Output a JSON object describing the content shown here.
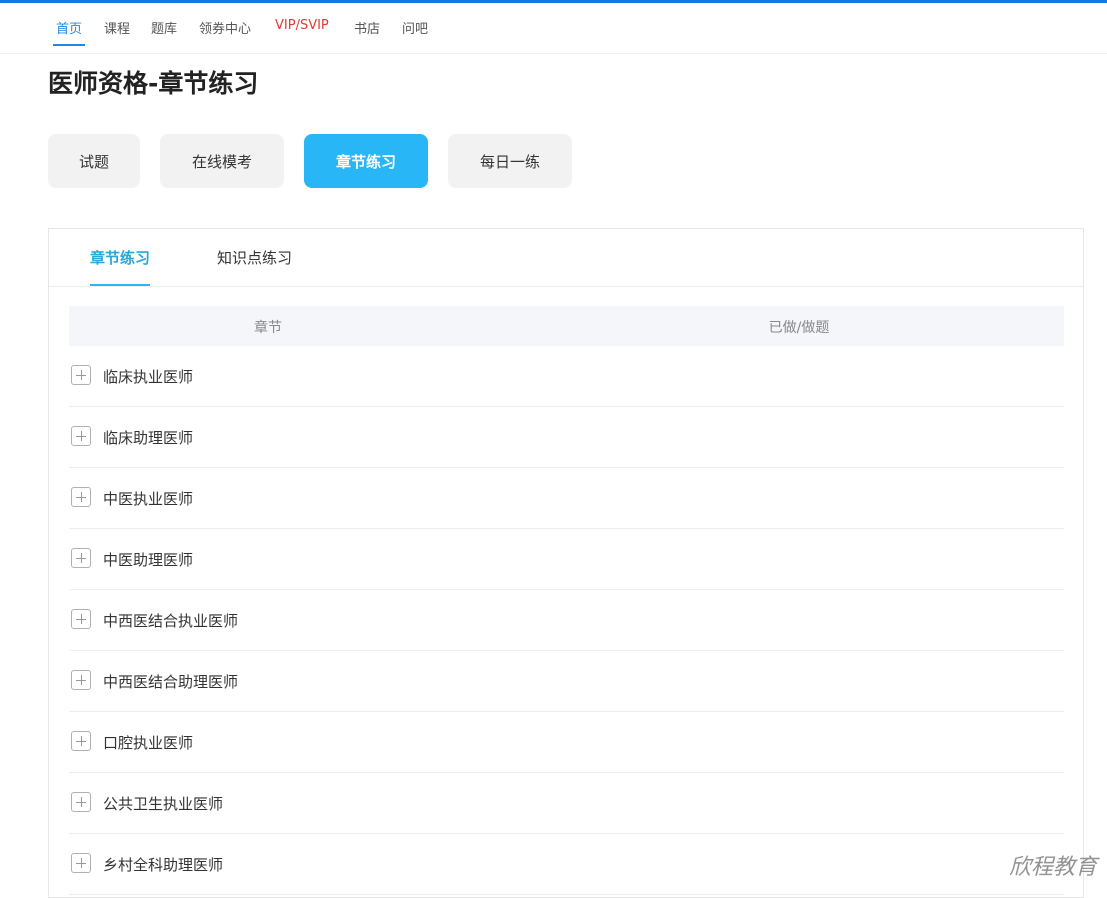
{
  "nav": {
    "items": [
      {
        "label": "首页"
      },
      {
        "label": "课程"
      },
      {
        "label": "题库"
      },
      {
        "label": "领券中心"
      },
      {
        "label": "VIP/SVIP"
      },
      {
        "label": "书店"
      },
      {
        "label": "问吧"
      }
    ]
  },
  "page": {
    "title": "医师资格-章节练习"
  },
  "modes": [
    {
      "label": "试题"
    },
    {
      "label": "在线模考"
    },
    {
      "label": "章节练习"
    },
    {
      "label": "每日一练"
    }
  ],
  "subtabs": [
    {
      "label": "章节练习"
    },
    {
      "label": "知识点练习"
    }
  ],
  "table": {
    "headers": {
      "chapter": "章节",
      "progress": "已做/做题"
    },
    "rows": [
      {
        "label": "临床执业医师"
      },
      {
        "label": "临床助理医师"
      },
      {
        "label": "中医执业医师"
      },
      {
        "label": "中医助理医师"
      },
      {
        "label": "中西医结合执业医师"
      },
      {
        "label": "中西医结合助理医师"
      },
      {
        "label": "口腔执业医师"
      },
      {
        "label": "公共卫生执业医师"
      },
      {
        "label": "乡村全科助理医师"
      }
    ]
  },
  "watermark": "欣程教育",
  "colors": {
    "accent": "#29b6f6",
    "nav_active": "#1e88e5",
    "vip": "#e53935"
  }
}
